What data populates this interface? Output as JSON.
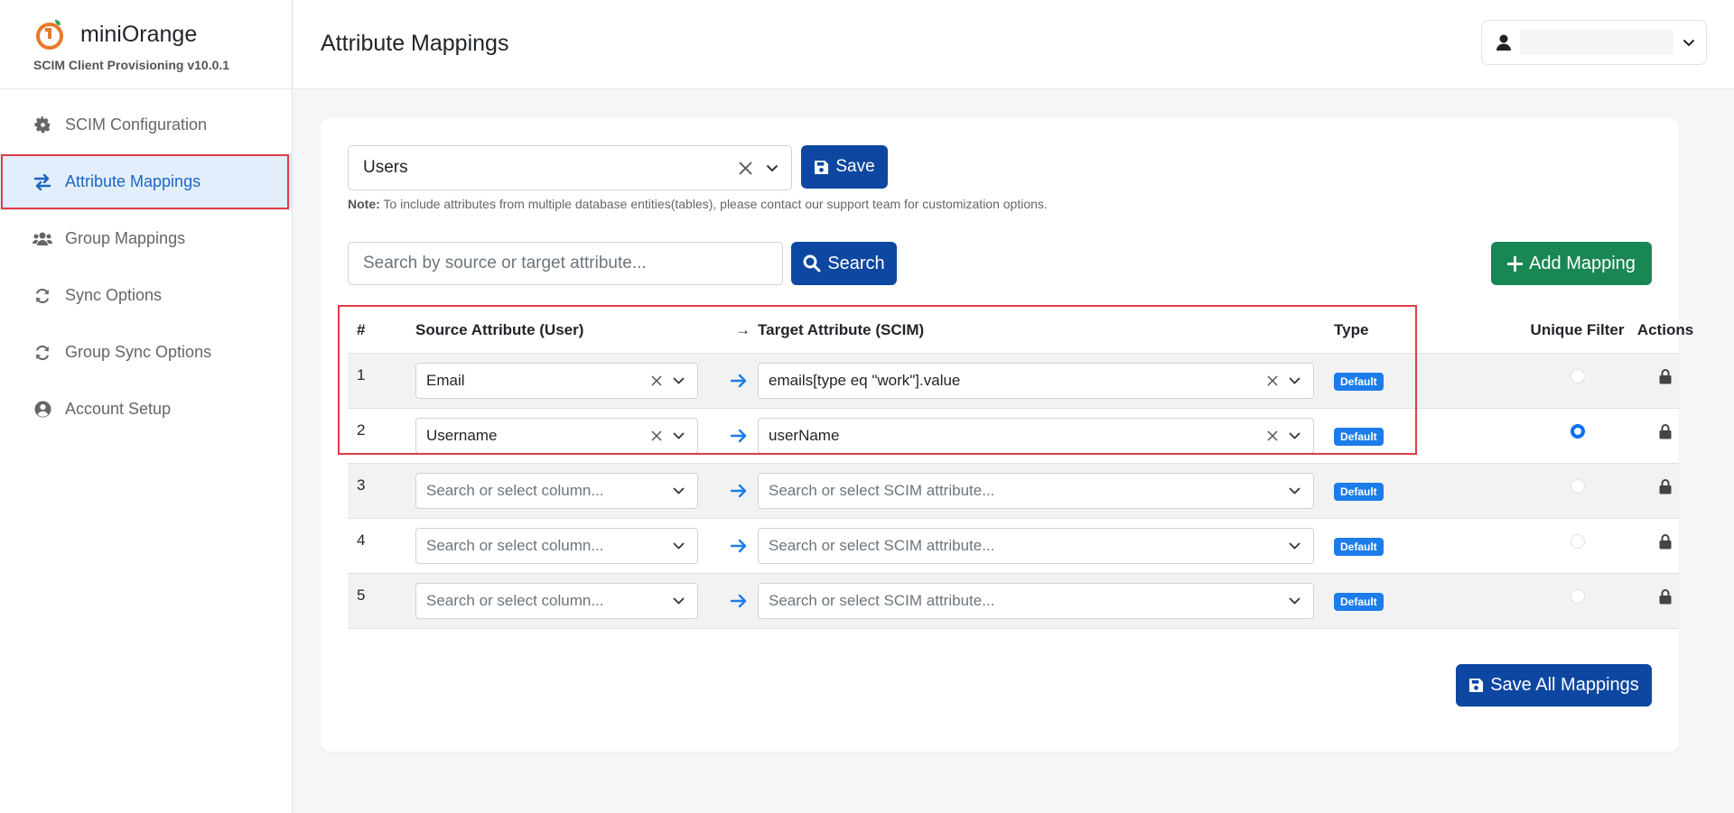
{
  "brand": {
    "name": "miniOrange",
    "version": "SCIM Client Provisioning v10.0.1"
  },
  "sidebar": {
    "items": [
      {
        "label": "SCIM Configuration",
        "icon": "gear-icon"
      },
      {
        "label": "Attribute Mappings",
        "icon": "exchange-arrows-icon"
      },
      {
        "label": "Group Mappings",
        "icon": "users-icon"
      },
      {
        "label": "Sync Options",
        "icon": "sync-icon"
      },
      {
        "label": "Group Sync Options",
        "icon": "sync-icon"
      },
      {
        "label": "Account Setup",
        "icon": "user-circle-icon"
      }
    ]
  },
  "header": {
    "title": "Attribute Mappings"
  },
  "entity": {
    "value": "Users",
    "save_label": "Save"
  },
  "note": {
    "label": "Note:",
    "text": "To include attributes from multiple database entities(tables), please contact our support team for customization options."
  },
  "search": {
    "placeholder": "Search by source or target attribute...",
    "button": "Search"
  },
  "add_button": "Add Mapping",
  "table": {
    "headers": {
      "num": "#",
      "source": "Source Attribute (User)",
      "arrow": "→",
      "target": "Target Attribute (SCIM)",
      "type": "Type",
      "unique": "Unique Filter",
      "actions": "Actions"
    },
    "source_placeholder": "Search or select column...",
    "target_placeholder": "Search or select SCIM attribute...",
    "rows": [
      {
        "num": "1",
        "source": "Email",
        "target": "emails[type eq \"work\"].value",
        "type": "Default",
        "unique": false
      },
      {
        "num": "2",
        "source": "Username",
        "target": "userName",
        "type": "Default",
        "unique": true
      },
      {
        "num": "3",
        "source": "",
        "target": "",
        "type": "Default",
        "unique": false
      },
      {
        "num": "4",
        "source": "",
        "target": "",
        "type": "Default",
        "unique": false
      },
      {
        "num": "5",
        "source": "",
        "target": "",
        "type": "Default",
        "unique": false
      }
    ]
  },
  "save_all": "Save All Mappings",
  "colors": {
    "primary": "#0d47a1",
    "success": "#198754",
    "badge": "#1c7cea",
    "highlight": "#e03d45",
    "active_bg": "#e2eefb",
    "active_text": "#1c66c4",
    "logo": "#e8792b"
  }
}
